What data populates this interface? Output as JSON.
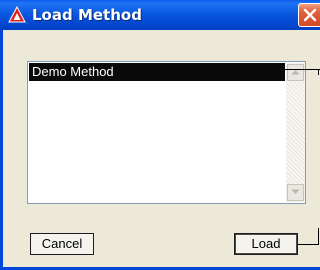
{
  "window": {
    "title": "Load Method",
    "close_icon": "close-icon",
    "app_icon": "app-logo-icon"
  },
  "method_list": {
    "items": [
      {
        "label": "Demo Method",
        "selected": true
      }
    ]
  },
  "buttons": {
    "cancel_label": "Cancel",
    "load_label": "Load"
  },
  "colors": {
    "titlebar": "#0a5ae8",
    "selection": "#0a0a0a",
    "dialog_bg": "#ece9d8",
    "close_button": "#d04a26"
  }
}
